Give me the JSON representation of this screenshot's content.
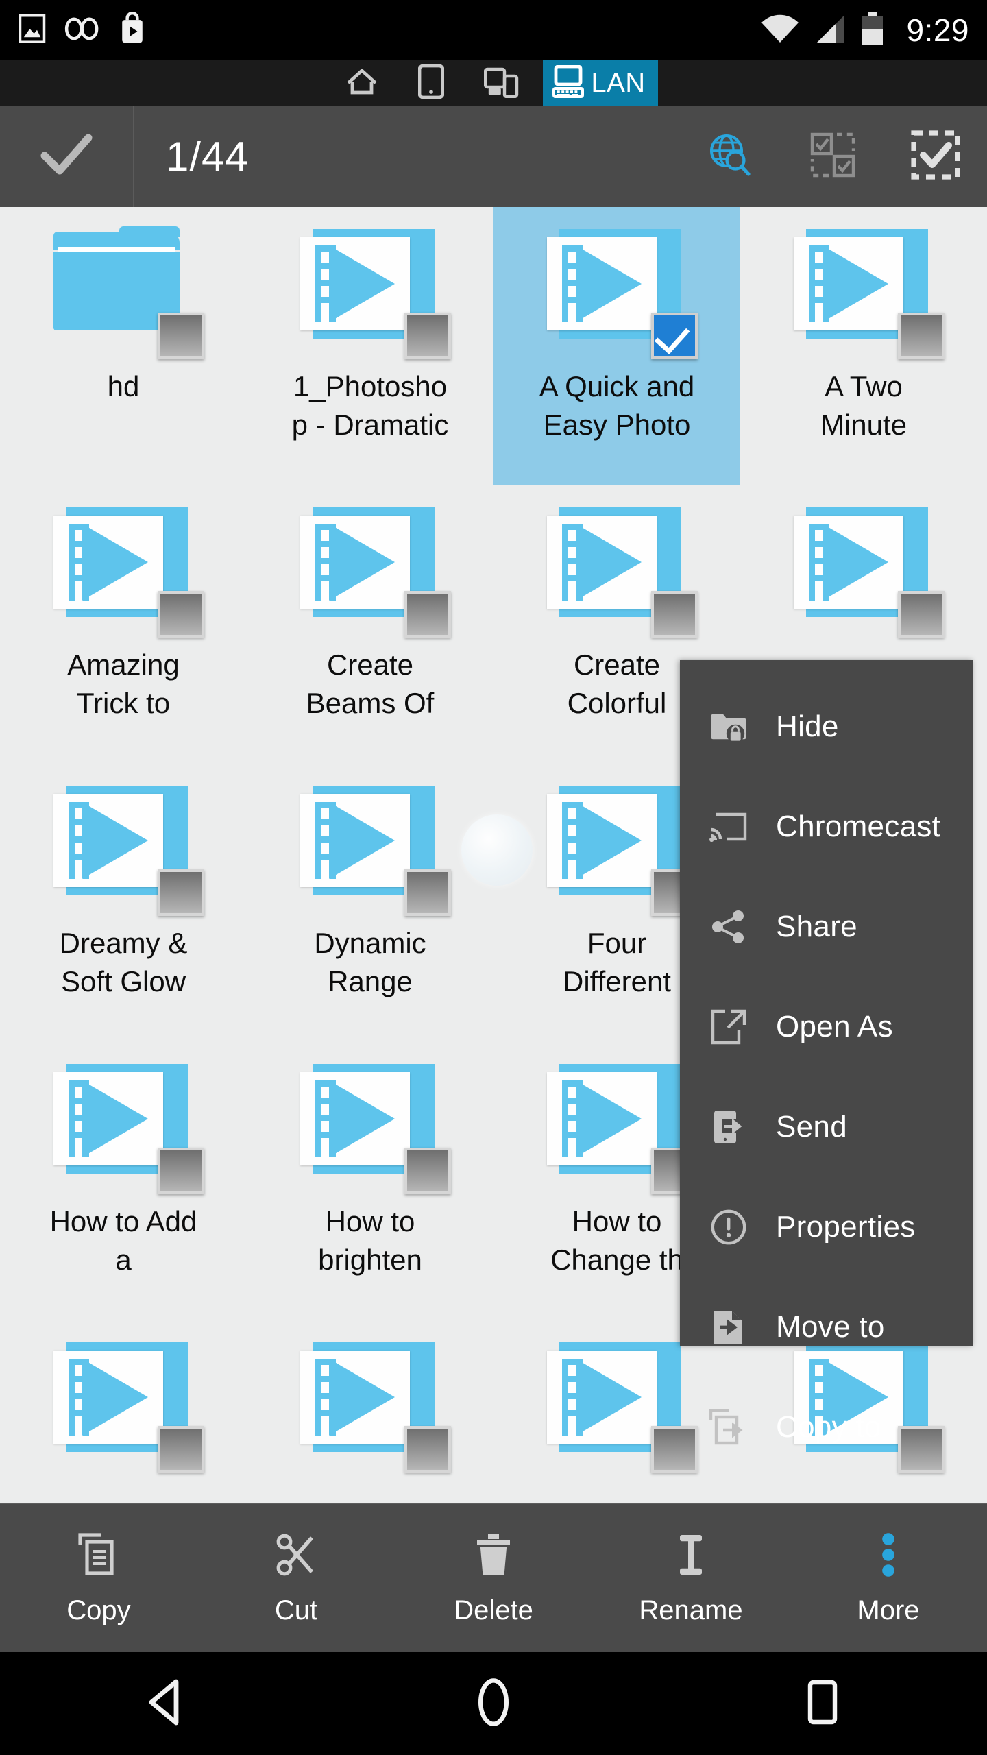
{
  "status_bar": {
    "icons": [
      "image-icon",
      "voicemail-icon",
      "play-store-icon",
      "wifi-icon",
      "signal-icon",
      "battery-icon"
    ],
    "clock": "9:29"
  },
  "tab_bar": {
    "tabs": [
      {
        "label": "",
        "icon": "home-icon",
        "active": false
      },
      {
        "label": "",
        "icon": "device-icon",
        "active": false
      },
      {
        "label": "",
        "icon": "transfer-icon",
        "active": false
      },
      {
        "label": "LAN",
        "icon": "computer-icon",
        "active": true
      }
    ],
    "active_color": "#0a7ea8"
  },
  "action_bar": {
    "confirm_icon": "check-icon",
    "selection_count": "1/44",
    "icons": [
      {
        "name": "globe-search-icon",
        "color": "#29a5dc",
        "enabled": true
      },
      {
        "name": "invert-selection-icon",
        "color": "#8e8e8e",
        "enabled": false
      },
      {
        "name": "select-all-icon",
        "color": "#e0e0e0",
        "enabled": true
      }
    ]
  },
  "grid": {
    "selection_bg": "#8ecbe8",
    "accent": "#5ec4ec",
    "rows": [
      [
        {
          "name": "hd",
          "type": "folder",
          "selected": false,
          "badge": "thumbnail"
        },
        {
          "name": "1_Photosho\np - Dramatic",
          "type": "video",
          "selected": false,
          "badge": "thumbnail"
        },
        {
          "name": "A Quick and\nEasy Photo",
          "type": "video",
          "selected": true,
          "badge": "checkbox"
        },
        {
          "name": "A Two\nMinute",
          "type": "video",
          "selected": false,
          "badge": "thumbnail"
        }
      ],
      [
        {
          "name": "Amazing\nTrick to",
          "type": "video",
          "selected": false,
          "badge": "thumbnail"
        },
        {
          "name": "Create\nBeams Of",
          "type": "video",
          "selected": false,
          "badge": "thumbnail"
        },
        {
          "name": "Create\nColorful",
          "type": "video",
          "selected": false,
          "badge": "thumbnail"
        },
        {
          "name": "",
          "type": "video",
          "selected": false,
          "badge": "thumbnail"
        }
      ],
      [
        {
          "name": "Dreamy &\nSoft Glow",
          "type": "video",
          "selected": false,
          "badge": "thumbnail"
        },
        {
          "name": "Dynamic\nRange",
          "type": "video",
          "selected": false,
          "badge": "thumbnail"
        },
        {
          "name": "Four\nDifferent",
          "type": "video",
          "selected": false,
          "badge": "thumbnail"
        },
        {
          "name": "",
          "type": "video",
          "selected": false,
          "badge": "thumbnail"
        }
      ],
      [
        {
          "name": "How to Add\na",
          "type": "video",
          "selected": false,
          "badge": "thumbnail"
        },
        {
          "name": "How to\nbrighten",
          "type": "video",
          "selected": false,
          "badge": "thumbnail"
        },
        {
          "name": "How to\nChange th",
          "type": "video",
          "selected": false,
          "badge": "thumbnail"
        },
        {
          "name": "",
          "type": "video",
          "selected": false,
          "badge": "thumbnail"
        }
      ],
      [
        {
          "name": "",
          "type": "video",
          "selected": false,
          "badge": "thumbnail"
        },
        {
          "name": "",
          "type": "video",
          "selected": false,
          "badge": "thumbnail"
        },
        {
          "name": "",
          "type": "video",
          "selected": false,
          "badge": "thumbnail"
        },
        {
          "name": "",
          "type": "video",
          "selected": false,
          "badge": "thumbnail"
        }
      ]
    ]
  },
  "context_menu": {
    "items": [
      {
        "label": "Hide",
        "icon": "folder-lock-icon"
      },
      {
        "label": "Chromecast",
        "icon": "cast-icon"
      },
      {
        "label": "Share",
        "icon": "share-icon"
      },
      {
        "label": "Open As",
        "icon": "open-external-icon"
      },
      {
        "label": "Send",
        "icon": "send-device-icon"
      },
      {
        "label": "Properties",
        "icon": "info-icon"
      },
      {
        "label": "Move to",
        "icon": "move-file-icon"
      },
      {
        "label": "Copy to",
        "icon": "copy-file-icon"
      }
    ]
  },
  "bottom_bar": {
    "items": [
      {
        "label": "Copy",
        "icon": "copy-icon",
        "accent": false
      },
      {
        "label": "Cut",
        "icon": "scissors-icon",
        "accent": false
      },
      {
        "label": "Delete",
        "icon": "trash-icon",
        "accent": false
      },
      {
        "label": "Rename",
        "icon": "text-cursor-icon",
        "accent": false
      },
      {
        "label": "More",
        "icon": "overflow-dots-icon",
        "accent": true
      }
    ],
    "accent_color": "#29a5dc"
  },
  "nav_bar": {
    "items": [
      {
        "name": "back-button",
        "icon": "triangle-back-icon"
      },
      {
        "name": "home-button",
        "icon": "circle-home-icon"
      },
      {
        "name": "recents-button",
        "icon": "square-recents-icon"
      }
    ]
  }
}
